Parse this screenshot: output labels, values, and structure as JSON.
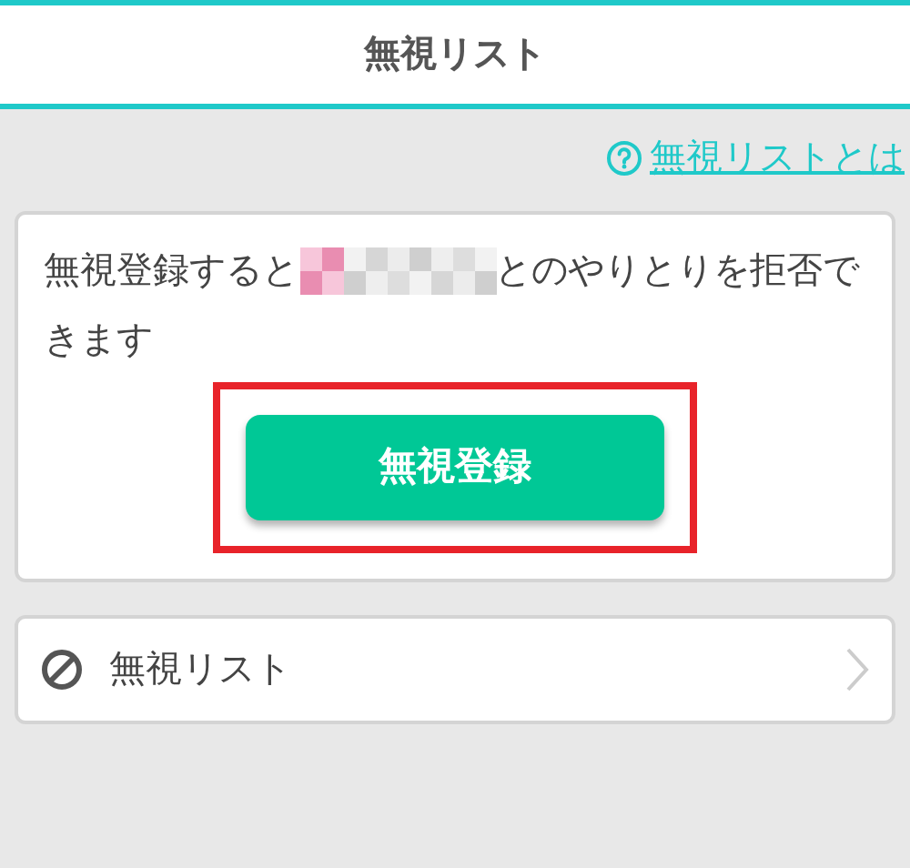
{
  "header": {
    "title": "無視リスト"
  },
  "help_link": {
    "label": "無視リストとは"
  },
  "info_card": {
    "text_before": "無視登録すると",
    "name_redacted": true,
    "text_after": "とのやりとりを拒否できます",
    "button": {
      "label": "無視登録",
      "highlighted": true
    }
  },
  "menu_items": [
    {
      "label": "無視リスト",
      "kind": "blocked"
    }
  ]
}
